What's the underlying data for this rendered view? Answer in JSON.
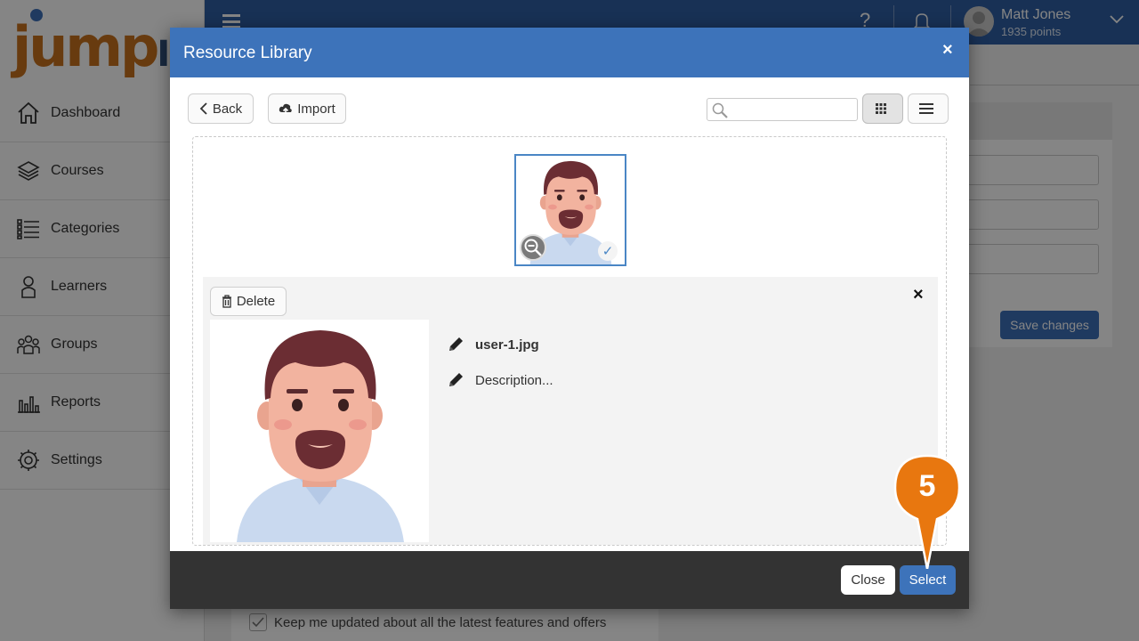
{
  "brand": {
    "logo_text": "jump",
    "logo_suffix": "Im"
  },
  "sidebar": {
    "items": [
      {
        "label": "Dashboard",
        "icon": "home-icon"
      },
      {
        "label": "Courses",
        "icon": "layers-icon"
      },
      {
        "label": "Categories",
        "icon": "list-icon"
      },
      {
        "label": "Learners",
        "icon": "person-icon"
      },
      {
        "label": "Groups",
        "icon": "group-icon"
      },
      {
        "label": "Reports",
        "icon": "bar-chart-icon"
      },
      {
        "label": "Settings",
        "icon": "gear-icon"
      }
    ]
  },
  "topbar": {
    "help": "?",
    "user_name": "Matt Jones",
    "user_points": "1935 points"
  },
  "background": {
    "save_label": "Save changes",
    "keep_updated_label": "Keep me updated about all the latest features and offers"
  },
  "modal": {
    "title": "Resource Library",
    "close_glyph": "×",
    "toolbar": {
      "back_label": "Back",
      "import_label": "Import",
      "search_placeholder": "",
      "search_value": ""
    },
    "detail": {
      "delete_label": "Delete",
      "close_glyph": "×",
      "file_name": "user-1.jpg",
      "description_placeholder": "Description..."
    },
    "footer": {
      "close_label": "Close",
      "select_label": "Select"
    }
  },
  "step_marker": {
    "number": "5"
  },
  "colors": {
    "primary": "#3d73ba",
    "topbar": "#2f5fa3",
    "logo_orange": "#c7711e",
    "marker_orange": "#e8770f",
    "footer": "#333333"
  }
}
